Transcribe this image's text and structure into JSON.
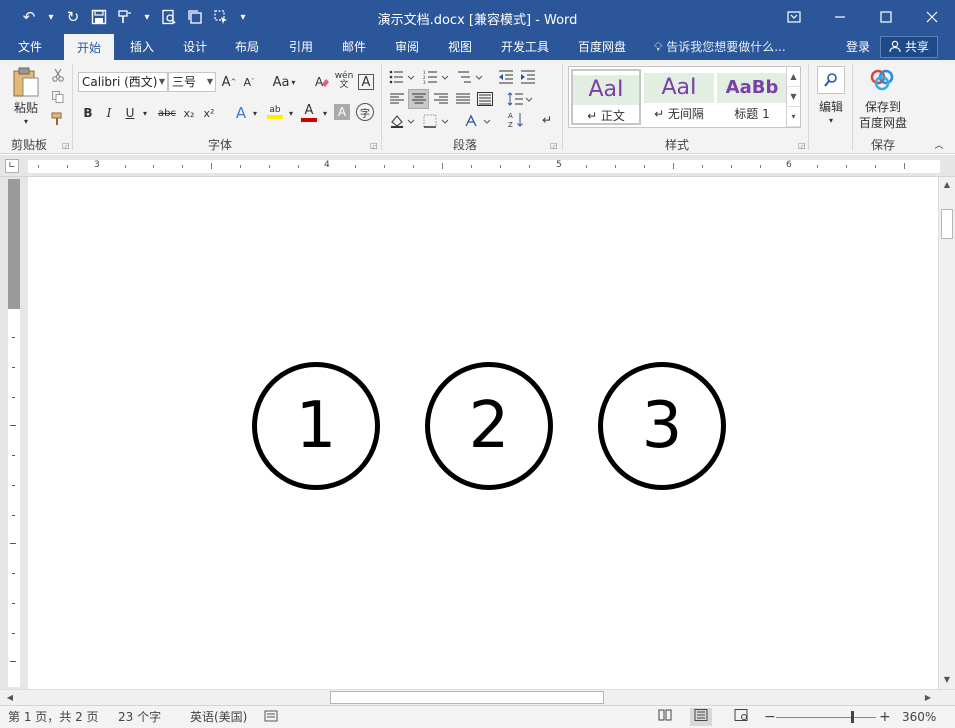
{
  "titlebar": {
    "title": "演示文档.docx [兼容模式] - Word",
    "qat": {
      "undo": "↶",
      "redo": "↻",
      "save": "🖫",
      "more": "▾"
    },
    "controls": {
      "ribbon_options": "⧉",
      "minimize": "—",
      "maximize": "☐",
      "close": "✕"
    }
  },
  "tabs": [
    {
      "label": "文件"
    },
    {
      "label": "开始"
    },
    {
      "label": "插入"
    },
    {
      "label": "设计"
    },
    {
      "label": "布局"
    },
    {
      "label": "引用"
    },
    {
      "label": "邮件"
    },
    {
      "label": "审阅"
    },
    {
      "label": "视图"
    },
    {
      "label": "开发工具"
    },
    {
      "label": "百度网盘"
    }
  ],
  "tellme": "告诉我您想要做什么...",
  "login": "登录",
  "share": "共享",
  "ribbon": {
    "clipboard": {
      "paste": "粘贴",
      "label": "剪贴板"
    },
    "font": {
      "name": "Calibri (西文)",
      "size": "三号",
      "label": "字体",
      "bold": "B",
      "italic": "I",
      "underline": "U",
      "strike": "abc",
      "sub": "x₂",
      "sup": "x²",
      "grow": "A",
      "shrink": "A",
      "case": "Aa",
      "phonetic": "wén",
      "phonetic_sub": "文",
      "border": "A",
      "effect": "A",
      "highlight": "ab",
      "color": "A",
      "shade": "A",
      "enclose": "字"
    },
    "paragraph": {
      "label": "段落"
    },
    "styles": {
      "label": "样式",
      "items": [
        {
          "sample": "AaI",
          "name": "↵ 正文"
        },
        {
          "sample": "AaI",
          "name": "↵ 无间隔"
        },
        {
          "sample": "AaBb",
          "name": "标题 1"
        }
      ]
    },
    "editing": {
      "label": "编辑"
    },
    "save": {
      "label": "保存",
      "button_line1": "保存到",
      "button_line2": "百度网盘"
    }
  },
  "ruler": {
    "numbers": [
      "3",
      "4",
      "5",
      "6"
    ]
  },
  "document": {
    "circles": [
      "1",
      "2",
      "3"
    ]
  },
  "status": {
    "page": "第 1 页，共 2 页",
    "words": "23 个字",
    "language": "英语(美国)",
    "zoom": "360%"
  }
}
